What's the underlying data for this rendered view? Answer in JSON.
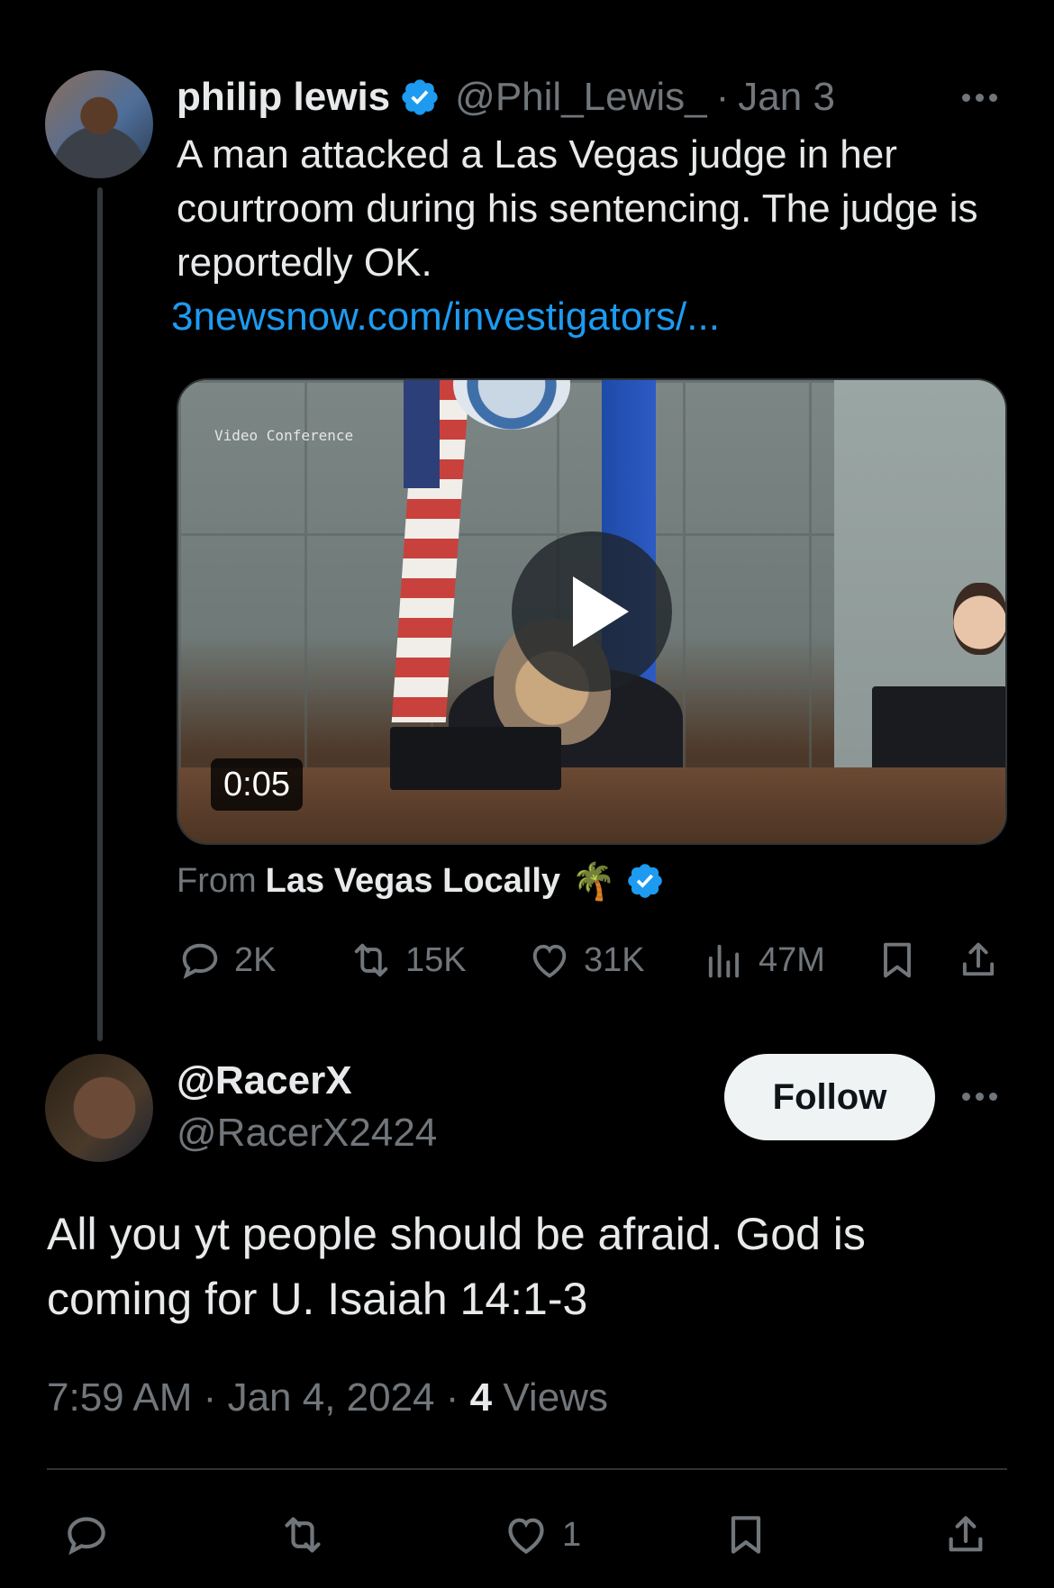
{
  "post": {
    "author_name": "philip lewis",
    "handle": "@Phil_Lewis_",
    "separator": "·",
    "date": "Jan 3",
    "text": "A man attacked a Las Vegas judge in her courtroom during his sentencing. The judge is reportedly OK.",
    "link_text": "3newsnow.com/investigators/...",
    "media": {
      "overlay_label": "Video Conference",
      "duration": "0:05"
    },
    "source": {
      "prefix": "From",
      "name": "Las Vegas Locally",
      "emoji": "🌴"
    },
    "metrics": {
      "replies": "2K",
      "reposts": "15K",
      "likes": "31K",
      "views": "47M"
    }
  },
  "reply": {
    "display_name": "@RacerX",
    "handle": "@RacerX2424",
    "follow_label": "Follow",
    "text": "All you yt people should be afraid. God is coming for U. Isaiah 14:1-3",
    "time": "7:59 AM",
    "separator": "·",
    "date": "Jan 4, 2024",
    "views_count": "4",
    "views_label": "Views",
    "metrics": {
      "likes": "1"
    }
  },
  "icons": [
    "verified-badge-icon",
    "more-icon",
    "play-icon",
    "reply-icon",
    "repost-icon",
    "like-icon",
    "views-icon",
    "bookmark-icon",
    "share-icon"
  ],
  "colors": {
    "background": "#000000",
    "text": "#e7e9ea",
    "muted": "#71767b",
    "link": "#1d9bf0",
    "verified": "#1d9bf0",
    "follow_bg": "#eff3f4"
  }
}
